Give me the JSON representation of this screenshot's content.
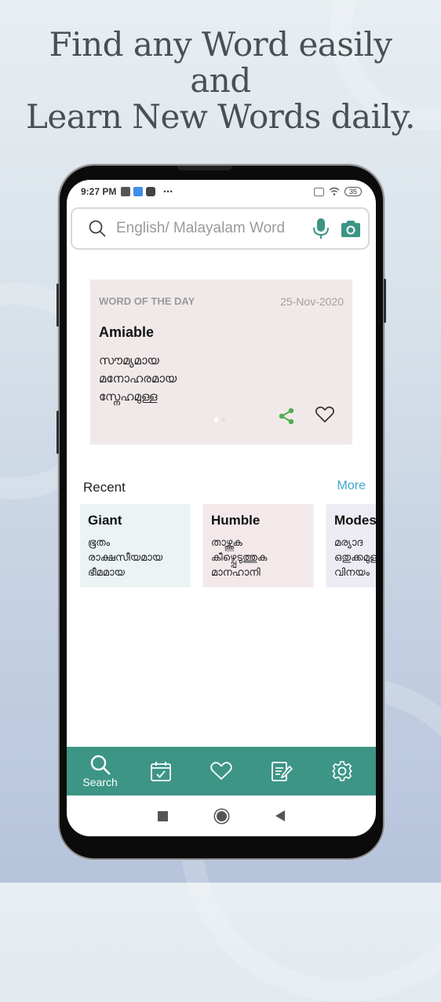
{
  "headline": {
    "line1": "Find any Word easily",
    "line2": "and",
    "line3": "Learn New Words daily."
  },
  "status_bar": {
    "time": "9:27 PM",
    "battery": "35",
    "icons": [
      "app-icon-1",
      "app-icon-2",
      "youtube-icon",
      "more-dots-icon",
      "sim-icon",
      "wifi-icon",
      "battery-icon"
    ],
    "more": "•••"
  },
  "search": {
    "placeholder": "English/ Malayalam Word",
    "icons": [
      "search-icon",
      "microphone-icon",
      "camera-icon"
    ]
  },
  "word_of_day": {
    "label": "WORD OF THE DAY",
    "date": "25-Nov-2020",
    "word": "Amiable",
    "meanings": [
      "സൗമ്യമായ",
      "മനോഹരമായ",
      "സ്നേഹമുള്ള"
    ],
    "page_index": 1,
    "page_count": 2
  },
  "recent": {
    "title": "Recent",
    "more_label": "More",
    "items": [
      {
        "word": "Giant",
        "meanings": [
          "ഭൂതം",
          "രാക്ഷസീയമായ",
          "ഭീമമായ"
        ],
        "color": "#ecf3f5"
      },
      {
        "word": "Humble",
        "meanings": [
          "താഴ്ത്തുക",
          "കീഴ്പ്പെടുത്തുക",
          "മാനഹാനി"
        ],
        "color": "#f3e9ea"
      },
      {
        "word": "Modest",
        "meanings": [
          "മര്യാദ",
          "ഒതുക്കമുള്ള",
          "വിനയം"
        ],
        "color": "#edecf4"
      }
    ]
  },
  "bottom_nav": {
    "items": [
      {
        "icon": "search-icon",
        "label": "Search",
        "active": true
      },
      {
        "icon": "calendar-check-icon",
        "label": ""
      },
      {
        "icon": "heart-icon",
        "label": ""
      },
      {
        "icon": "notepad-edit-icon",
        "label": ""
      },
      {
        "icon": "gear-icon",
        "label": ""
      }
    ]
  },
  "colors": {
    "accent": "#3d9585",
    "link": "#3ea6cf",
    "share": "#4caf50"
  }
}
